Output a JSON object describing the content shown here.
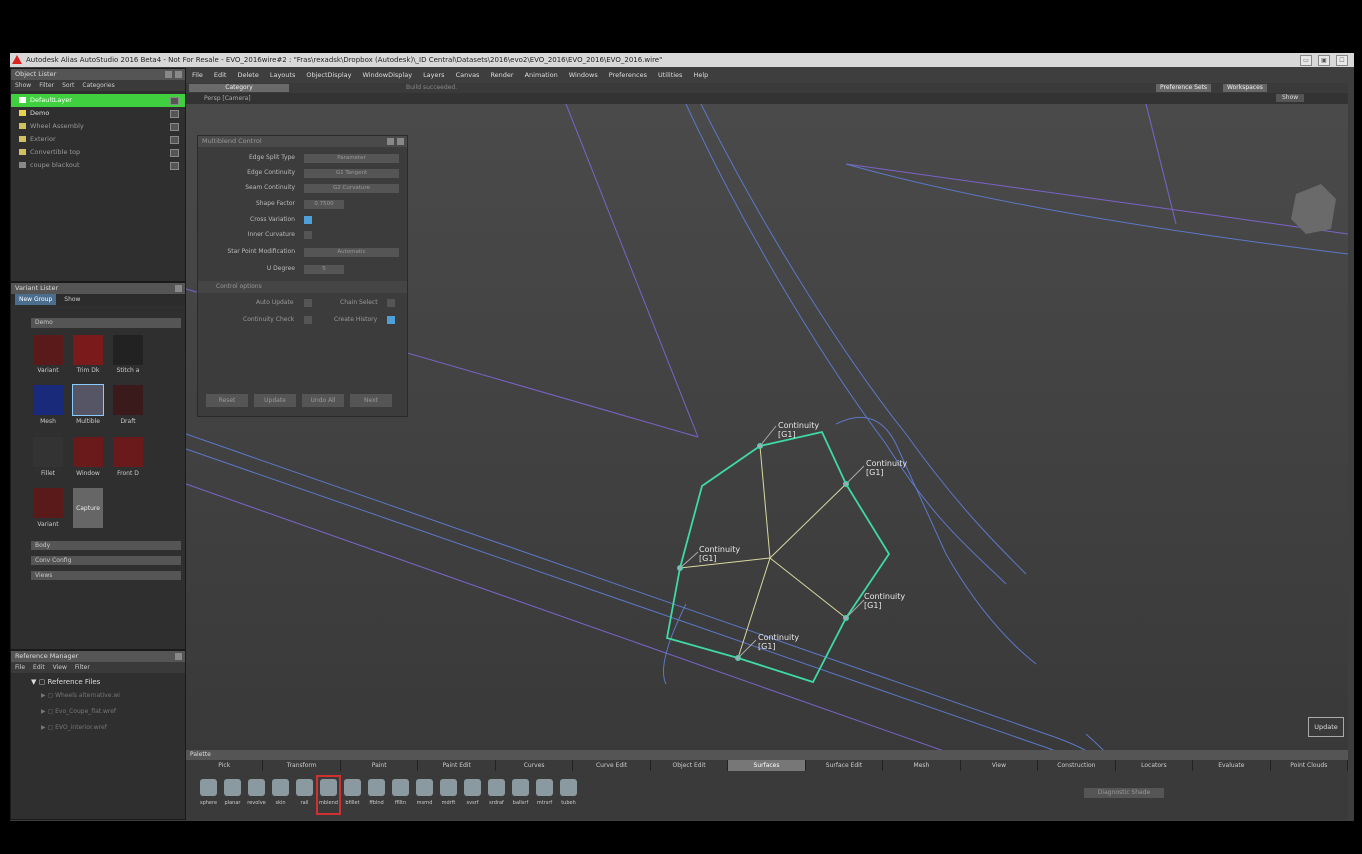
{
  "window": {
    "title": "Autodesk Alias AutoStudio 2016 Beta4 - Not For Resale  - EVO_2016wire#2 : \"Fras\\rexadsk\\Dropbox (Autodesk)\\_ID Central\\Datasets\\2016\\evo2\\EVO_2016\\EVO_2016\\EVO_2016.wire\"",
    "controls": [
      "▭",
      "▣",
      "☐"
    ]
  },
  "menu": [
    "File",
    "Edit",
    "Delete",
    "Layouts",
    "ObjectDisplay",
    "WindowDisplay",
    "Layers",
    "Canvas",
    "Render",
    "Animation",
    "Windows",
    "Preferences",
    "Utilities",
    "Help"
  ],
  "toolbar": {
    "category": "Category",
    "status": "Build succeeded.",
    "camera": "Persp [Camera]",
    "pref_sets": "Preference Sets",
    "workspaces": "Workspaces",
    "show": "Show"
  },
  "object_lister": {
    "title": "Object Lister",
    "menu": [
      "Show",
      "Filter",
      "Sort",
      "Categories"
    ],
    "layers": [
      {
        "name": "DefaultLayer",
        "color": "#ffffff",
        "selected": true
      },
      {
        "name": "Demo",
        "color": "#e8d050",
        "selected": false
      },
      {
        "name": "Wheel Assembly",
        "color": "#d0c060",
        "selected": false
      },
      {
        "name": "Exterior",
        "color": "#d0c060",
        "selected": false
      },
      {
        "name": "Convertible top",
        "color": "#d0c060",
        "selected": false
      },
      {
        "name": "coupe blackout",
        "color": "#888888",
        "selected": false
      }
    ]
  },
  "variant_lister": {
    "title": "Variant Lister",
    "tabs": [
      "New Group",
      "Show"
    ],
    "group": "Demo",
    "thumbs": [
      "Variant",
      "Trim Dk",
      "Stitch a",
      "Mesh",
      "Multible",
      "Draft",
      "Fillet",
      "Window",
      "Front D",
      "Variant",
      "Capture"
    ],
    "sliders": [
      "Body",
      "Conv Config",
      "Views"
    ]
  },
  "multiblend": {
    "title": "Multiblend Control",
    "rows": [
      {
        "label": "Edge Split Type",
        "value": "Parameter"
      },
      {
        "label": "Edge Continuity",
        "value": "G1 Tangent"
      },
      {
        "label": "Seam Continuity",
        "value": "G2 Curvature"
      },
      {
        "label": "Shape Factor",
        "value": "0.7500"
      },
      {
        "label": "Cross Variation",
        "value": ""
      },
      {
        "label": "Inner Curvature",
        "value": ""
      },
      {
        "label": "Star Point Modification",
        "value": "Automatic"
      },
      {
        "label": "U Degree",
        "value": "5"
      }
    ],
    "control_options": "Control options",
    "auto_update": "Auto Update",
    "chain_select": "Chain Select",
    "continuity_check": "Continuity Check",
    "create_history": "Create History",
    "buttons": [
      "Reset",
      "Update",
      "Undo All",
      "Next"
    ]
  },
  "reference_manager": {
    "title": "Reference Manager",
    "menu": [
      "File",
      "Edit",
      "View",
      "Filter"
    ],
    "root": "Reference Files",
    "files": [
      "Wheels alternative.wi",
      "Evo_Coupe_flat.wref",
      "EVO_interior.wref"
    ]
  },
  "viewport": {
    "labels": [
      {
        "name": "Continuity",
        "value": "[G1]"
      },
      {
        "name": "Continuity",
        "value": "[G1]"
      },
      {
        "name": "Continuity",
        "value": "[G1]"
      },
      {
        "name": "Continuity",
        "value": "[G1]"
      },
      {
        "name": "Continuity",
        "value": "[G1]"
      }
    ],
    "update_btn": "Update"
  },
  "palette": {
    "title": "Palette",
    "tabs": [
      "Pick",
      "Transform",
      "Paint",
      "Paint Edit",
      "Curves",
      "Curve Edit",
      "Object Edit",
      "Surfaces",
      "Surface Edit",
      "Mesh",
      "View",
      "Construction",
      "Locators",
      "Evaluate",
      "Point Clouds"
    ],
    "active_tab": "Surfaces",
    "tools": [
      "sphere",
      "planar",
      "revolve",
      "skin",
      "rail",
      "mblend",
      "bfillet",
      "ffblnd",
      "fflltn",
      "msrnd",
      "mdrft",
      "svsrf",
      "srdraf",
      "ballsrf",
      "mtrsrf",
      "tubeh"
    ],
    "active_tool": "mblend",
    "diag_shade": "Diagnostic Shade"
  }
}
